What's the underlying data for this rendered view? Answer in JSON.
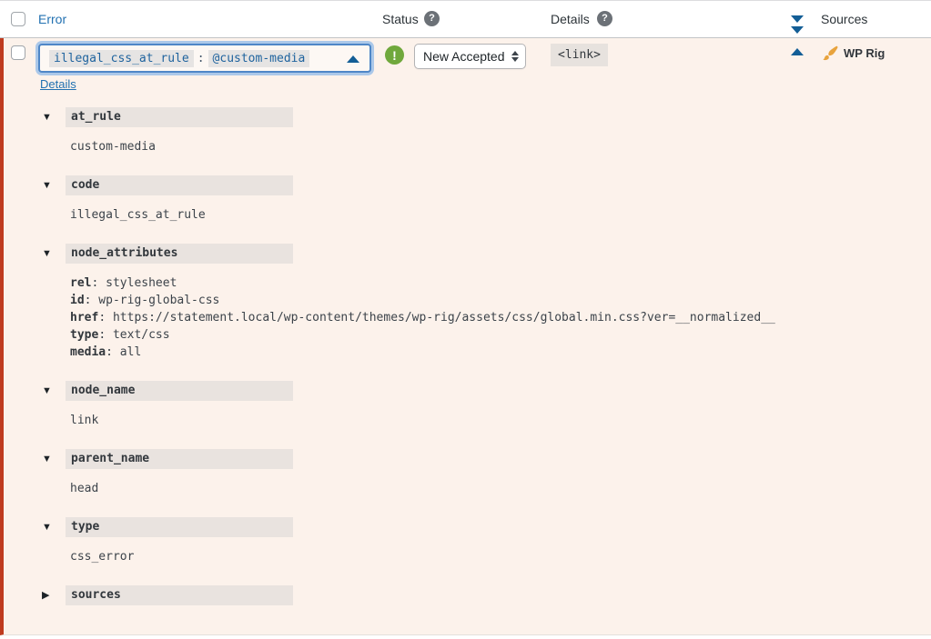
{
  "colors": {
    "row_background": "#fcf2eb",
    "row_left_border": "#bf3b1f",
    "link_blue": "#2271b1",
    "arrow_blue": "#135e96",
    "status_green": "#70a83c",
    "brush_orange": "#e8a33d",
    "focus_border": "#4f87c7"
  },
  "header": {
    "columns": {
      "error": "Error",
      "status": "Status",
      "details": "Details",
      "sources": "Sources"
    }
  },
  "row": {
    "error": {
      "code": "illegal_css_at_rule",
      "separator": ":",
      "value": "@custom-media"
    },
    "details_link": "Details",
    "status": {
      "select_value": "New Accepted"
    },
    "details_badge": "<link>",
    "source": {
      "name": "WP Rig"
    }
  },
  "sections": [
    {
      "label": "at_rule",
      "expanded": true,
      "lines": [
        {
          "value": "custom-media"
        }
      ]
    },
    {
      "label": "code",
      "expanded": true,
      "lines": [
        {
          "value": "illegal_css_at_rule"
        }
      ]
    },
    {
      "label": "node_attributes",
      "expanded": true,
      "lines": [
        {
          "key": "rel",
          "value": "stylesheet"
        },
        {
          "key": "id",
          "value": "wp-rig-global-css"
        },
        {
          "key": "href",
          "value": "https://statement.local/wp-content/themes/wp-rig/assets/css/global.min.css?ver=__normalized__"
        },
        {
          "key": "type",
          "value": "text/css"
        },
        {
          "key": "media",
          "value": "all"
        }
      ]
    },
    {
      "label": "node_name",
      "expanded": true,
      "lines": [
        {
          "value": "link"
        }
      ]
    },
    {
      "label": "parent_name",
      "expanded": true,
      "lines": [
        {
          "value": "head"
        }
      ]
    },
    {
      "label": "type",
      "expanded": true,
      "lines": [
        {
          "value": "css_error"
        }
      ]
    },
    {
      "label": "sources",
      "expanded": false,
      "lines": []
    }
  ]
}
